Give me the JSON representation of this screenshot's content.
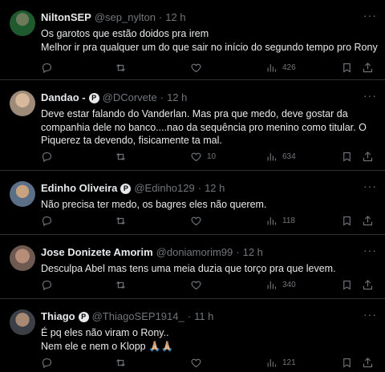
{
  "tweets": [
    {
      "name": "NiltonSEP",
      "verified": false,
      "handle": "@sep_nylton",
      "time": "12 h",
      "lines": [
        "Os garotos que estão doidos pra irem",
        "Melhor ir pra qualquer um do que sair no início do segundo tempo pro Rony"
      ],
      "likes": "",
      "views": "426"
    },
    {
      "name": "Dandao -",
      "verified": true,
      "handle": "@DCorvete",
      "time": "12 h",
      "lines": [
        "Deve estar falando do Vanderlan. Mas pra que medo, deve gostar da companhia dele no banco....nao da sequência pro menino como titular. O Piquerez ta devendo, fisicamente ta mal."
      ],
      "likes": "10",
      "views": "634"
    },
    {
      "name": "Edinho Oliveira",
      "verified": true,
      "handle": "@Edinho129",
      "time": "12 h",
      "lines": [
        "Não precisa ter medo, os bagres eles não querem."
      ],
      "likes": "",
      "views": "118"
    },
    {
      "name": "Jose Donizete Amorim",
      "verified": false,
      "handle": "@doniamorim99",
      "time": "12 h",
      "lines": [
        "Desculpa Abel mas tens uma meia duzia que torço pra que levem."
      ],
      "likes": "",
      "views": "340"
    },
    {
      "name": "Thiago",
      "verified": true,
      "handle": "@ThiagoSEP1914_",
      "time": "11 h",
      "lines": [
        "É pq eles não viram o Rony..",
        "Nem ele e nem o Klopp 🙏🏼🙏🏼"
      ],
      "likes": "",
      "views": "121"
    }
  ],
  "badge_glyph": "P",
  "separator": "·",
  "more_glyph": "···"
}
